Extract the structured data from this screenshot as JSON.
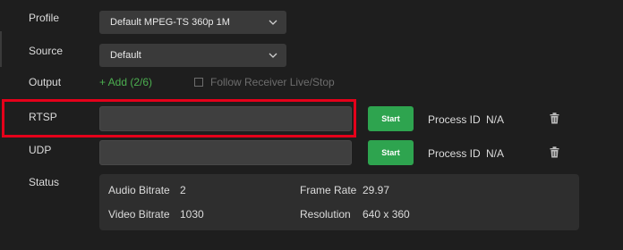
{
  "form": {
    "profile": {
      "label": "Profile",
      "value": "Default MPEG-TS 360p 1M"
    },
    "source": {
      "label": "Source",
      "value": "Default"
    },
    "output": {
      "label": "Output",
      "add_label": "+ Add (2/6)",
      "follow_label": "Follow Receiver Live/Stop",
      "follow_checked": false
    },
    "rtsp": {
      "label": "RTSP",
      "value": "",
      "start_label": "Start",
      "process_id_label": "Process ID",
      "process_id_value": "N/A",
      "highlighted": true
    },
    "udp": {
      "label": "UDP",
      "value": "",
      "start_label": "Start",
      "process_id_label": "Process ID",
      "process_id_value": "N/A"
    },
    "status": {
      "label": "Status",
      "audio_bitrate_label": "Audio Bitrate",
      "audio_bitrate_value": "2",
      "frame_rate_label": "Frame Rate",
      "frame_rate_value": "29.97",
      "video_bitrate_label": "Video Bitrate",
      "video_bitrate_value": "1030",
      "resolution_label": "Resolution",
      "resolution_value": "640 x 360"
    }
  },
  "colors": {
    "background": "#1e1e1e",
    "accent_green": "#2ea44f",
    "add_link_green": "#4caf50",
    "highlight_red": "#e5001a"
  },
  "icons": {
    "select_chevron": "chevron-down-icon",
    "delete": "trash-icon"
  }
}
